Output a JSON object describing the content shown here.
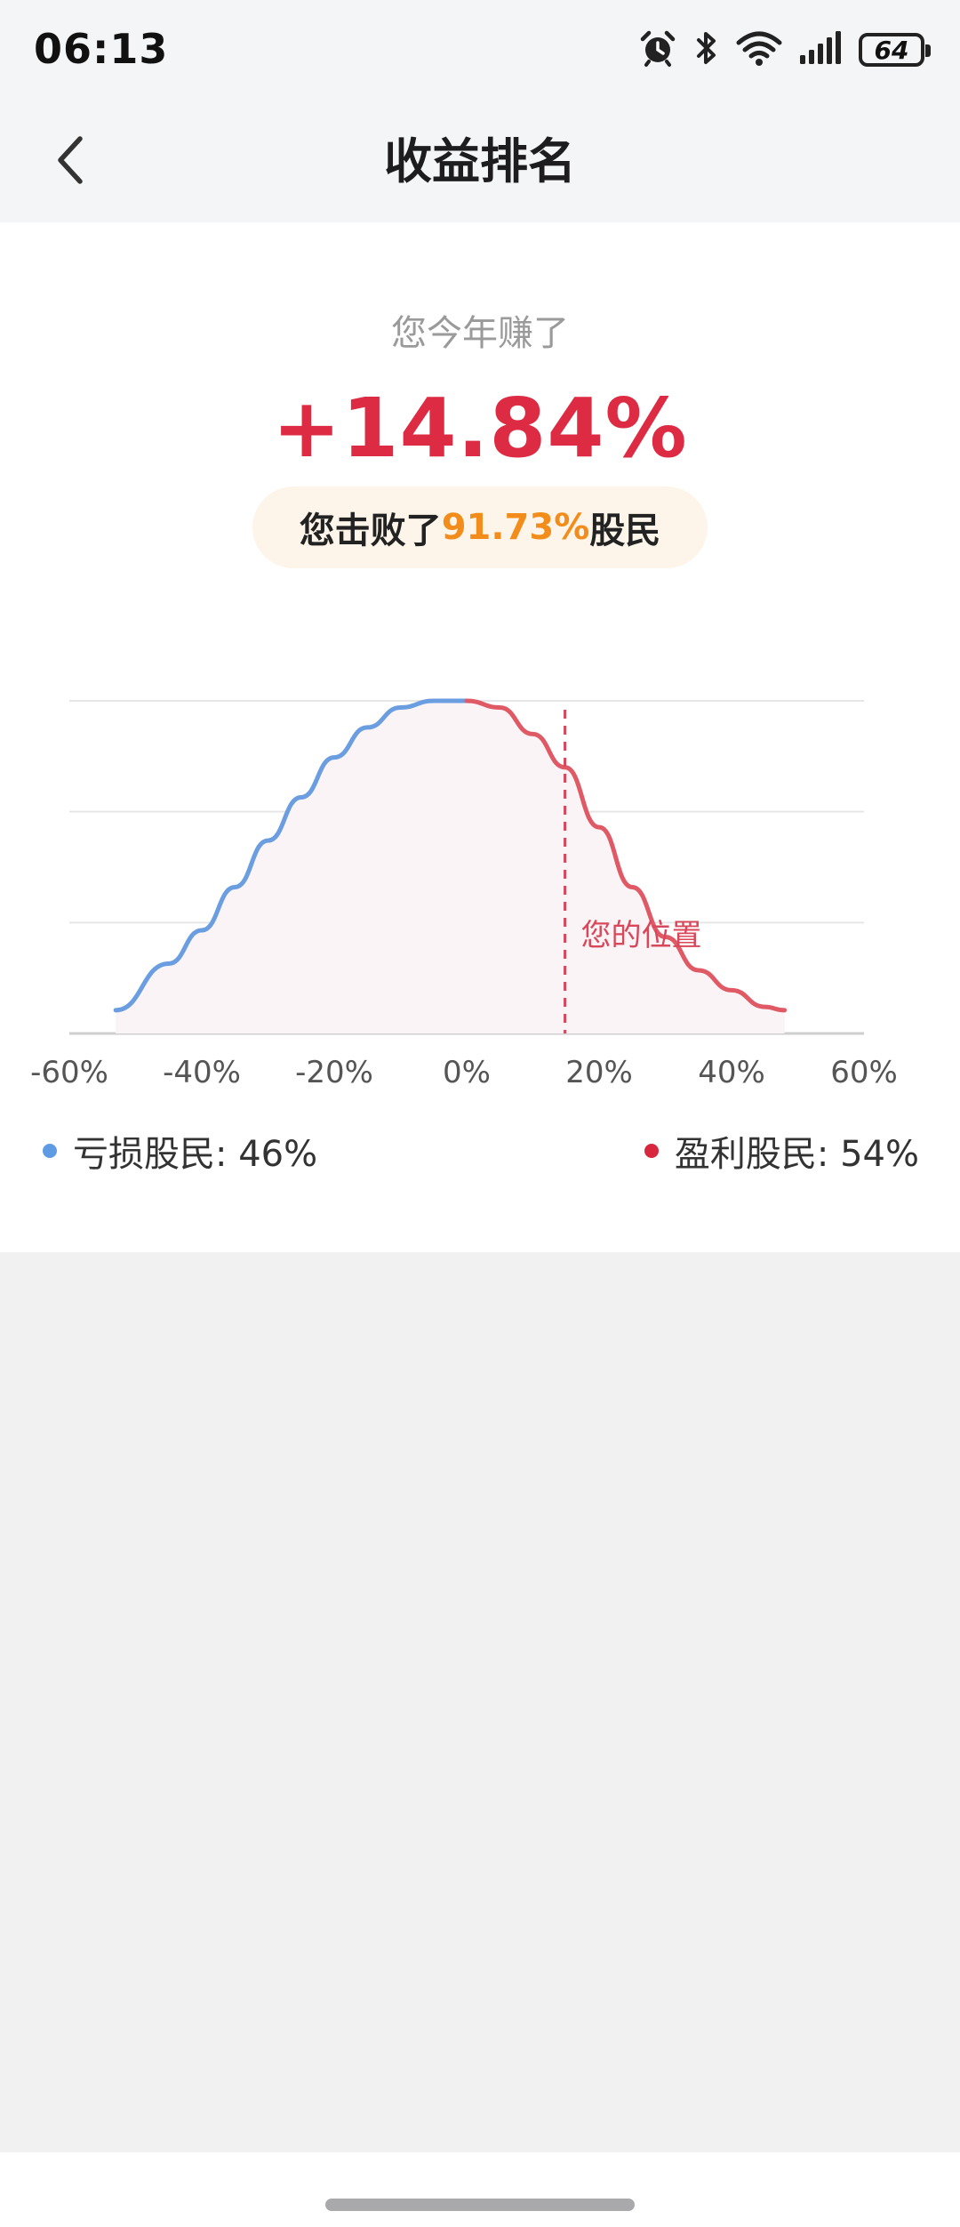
{
  "status_bar": {
    "time": "06:13",
    "battery": "64",
    "icons": [
      "alarm-icon",
      "bluetooth-icon",
      "wifi-icon",
      "signal-icon",
      "battery-icon"
    ]
  },
  "header": {
    "title": "收益排名",
    "back_icon": "chevron-left-icon"
  },
  "summary": {
    "earned_label": "您今年赚了",
    "return_value": "+14.84%",
    "rank_prefix": "您击败了",
    "rank_percent": "91.73%",
    "rank_suffix": "股民"
  },
  "chart_data": {
    "type": "area",
    "x_tick_labels": [
      "-60%",
      "-40%",
      "-20%",
      "0%",
      "20%",
      "40%",
      "60%"
    ],
    "xlim": [
      -60,
      60
    ],
    "series": [
      {
        "x": [
          -53,
          -45,
          -40,
          -35,
          -30,
          -25,
          -20,
          -15,
          -10,
          -5,
          0
        ],
        "y": [
          0.07,
          0.21,
          0.31,
          0.44,
          0.58,
          0.71,
          0.83,
          0.92,
          0.98,
          1.0,
          1.0
        ],
        "color": "#6b9ee0"
      },
      {
        "x": [
          0,
          5,
          10,
          14.84,
          20,
          25,
          30,
          35,
          40,
          45,
          48
        ],
        "y": [
          1.0,
          0.98,
          0.9,
          0.8,
          0.62,
          0.44,
          0.29,
          0.19,
          0.13,
          0.08,
          0.07
        ],
        "color": "#e05a66"
      }
    ],
    "marker": {
      "x": 14.84,
      "label": "您的位置",
      "color": "#d8485a"
    },
    "grid": true,
    "gridlines": 4
  },
  "legend": {
    "loss_label": "亏损股民: 46%",
    "loss_color": "#5e9be3",
    "profit_label": "盈利股民: 54%",
    "profit_color": "#d7263d"
  }
}
